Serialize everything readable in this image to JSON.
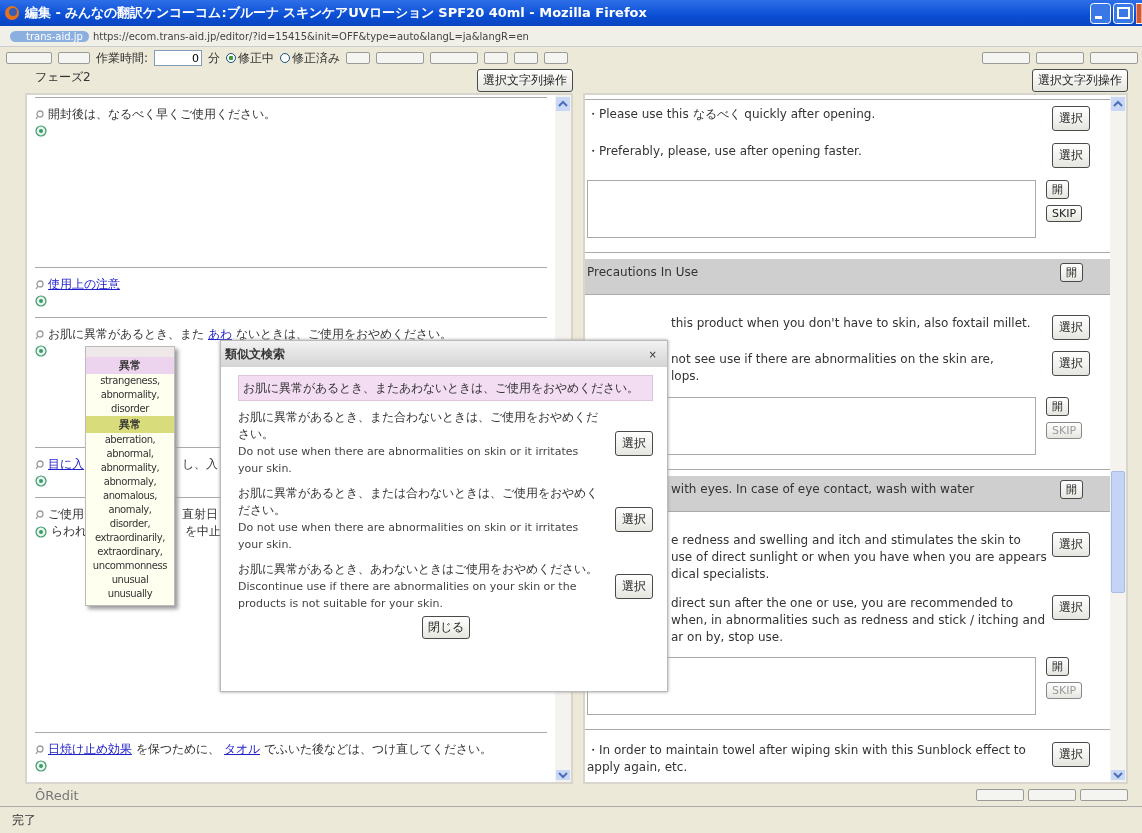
{
  "window": {
    "title": "編集 - みんなの翻訳ケンコーコム:ブルーナ スキンケアUVローション SPF20 40ml - Mozilla Firefox"
  },
  "address_bar": {
    "site_badge": "trans-aid.jp",
    "url": "https://ecom.trans-aid.jp/editor/?id=15415&init=OFF&type=auto&langL=ja&langR=en"
  },
  "work_time": {
    "label": "作業時間:",
    "value": "0",
    "unit": "分"
  },
  "status_options": [
    {
      "label": "修正中",
      "selected": true
    },
    {
      "label": "修正済み",
      "selected": false
    }
  ],
  "phase": "フェーズ2",
  "left_pane": {
    "action_button": "選択文字列操作",
    "segments": [
      {
        "source": [
          {
            "kind": "text",
            "text": "開封後は、なるべく早くご使用ください。"
          }
        ]
      },
      {
        "source": [
          {
            "kind": "link",
            "text": "使用上の注意"
          }
        ]
      },
      {
        "source": [
          {
            "kind": "text",
            "text": "お肌に異常があるとき、また"
          },
          {
            "kind": "link",
            "text": "あわ"
          },
          {
            "kind": "text",
            "text": "ないときは、ご使用をおやめください。"
          }
        ]
      },
      {
        "source": [
          {
            "kind": "link",
            "text": "目に入"
          },
          {
            "kind": "gap"
          },
          {
            "kind": "text",
            "text": "し、入"
          }
        ]
      },
      {
        "source": [
          {
            "kind": "text",
            "text": "ご使用"
          },
          {
            "kind": "gap"
          },
          {
            "kind": "text",
            "text": "直射日"
          }
        ],
        "target": [
          {
            "kind": "text",
            "text": "らわれ"
          },
          {
            "kind": "gap"
          },
          {
            "kind": "text",
            "text": "を中止"
          }
        ]
      },
      {
        "source": [
          {
            "kind": "link",
            "text": "日焼け止め効果"
          },
          {
            "kind": "text",
            "text": "を保つために、"
          },
          {
            "kind": "link",
            "text": "タオル"
          },
          {
            "kind": "text",
            "text": "でふいた後などは、つけ直してください。"
          }
        ]
      }
    ]
  },
  "right_pane": {
    "action_button": "選択文字列操作",
    "items": [
      {
        "kind": "candidate",
        "covered": false,
        "lines": [
          "・Please use this なるべく quickly after opening."
        ],
        "button": "選択"
      },
      {
        "kind": "candidate",
        "covered": false,
        "lines": [
          "・Preferably, please, use after opening faster."
        ],
        "button": "選択"
      },
      {
        "kind": "editor",
        "open_button": "開",
        "skip_button": "SKIP",
        "skip_disabled": false
      },
      {
        "kind": "heading",
        "covered": false,
        "lines": [
          "Precautions In Use"
        ],
        "button": "開"
      },
      {
        "kind": "candidate",
        "covered": true,
        "lines": [
          "this product when you don't have to skin, also foxtail millet."
        ],
        "button": "選択"
      },
      {
        "kind": "candidate",
        "covered": true,
        "lines": [
          "not see use if there are abnormalities on the skin are,",
          "lops."
        ],
        "button": "選択"
      },
      {
        "kind": "editor",
        "open_button": "開",
        "skip_button": "SKIP",
        "skip_disabled": true
      },
      {
        "kind": "heading",
        "covered": true,
        "lines": [
          "with eyes. In case of eye contact, wash with water"
        ],
        "button": "開"
      },
      {
        "kind": "candidate",
        "covered": true,
        "lines": [
          "e redness and swelling and itch and stimulates the skin to",
          "use of direct sunlight or when you have when you are appears",
          "dical specialists."
        ],
        "button": "選択"
      },
      {
        "kind": "candidate",
        "covered": true,
        "lines": [
          "direct sun after the one or use, you are recommended to",
          "when, in abnormalities such as redness and stick / itching and",
          "ar on by, stop use."
        ],
        "button": "選択"
      },
      {
        "kind": "editor",
        "open_button": "開",
        "skip_button": "SKIP",
        "skip_disabled": true
      },
      {
        "kind": "candidate",
        "covered": false,
        "lines": [
          "・In order to maintain towel after wiping skin with this Sunblock effect to apply again, etc."
        ],
        "button": "選択"
      }
    ]
  },
  "dictionary_popup": {
    "groups": [
      {
        "headword": "異常",
        "color": "#ecd3ee",
        "senses": [
          "strangeness,",
          "abnormality,",
          "disorder"
        ]
      },
      {
        "headword": "異常",
        "color": "#d9dc7a",
        "senses": [
          "aberration,",
          "abnormal,",
          "abnormality,",
          "abnormaly,",
          "anomalous,",
          "anomaly,",
          "disorder,",
          "extraordinarily,",
          "extraordinary,",
          "uncommonness",
          "unusual",
          "unusually"
        ]
      }
    ]
  },
  "dialog": {
    "title": "類似文検索",
    "close": "×",
    "query": "お肌に異常があるとき、またあわないときは、ご使用をおやめください。",
    "results": [
      {
        "ja": "お肌に異常があるとき、また合わないときは、ご使用をおやめください。",
        "en": "Do not use when there are abnormalities on skin or it irritates your skin.",
        "button": "選択"
      },
      {
        "ja": "お肌に異常があるとき、または合わないときは、ご使用をおやめください。",
        "en": "Do not use when there are abnormalities on skin or it irritates your skin.",
        "button": "選択"
      },
      {
        "ja": "お肌に異常があるとき、あわないときはご使用をおやめください。",
        "en": "Discontinue use if there are abnormalities on your skin or the products is not suitable for your skin.",
        "button": "選択"
      }
    ],
    "close_button": "閉じる"
  },
  "footer": {
    "logo": "ÔRedit"
  },
  "status_bar": "完了"
}
